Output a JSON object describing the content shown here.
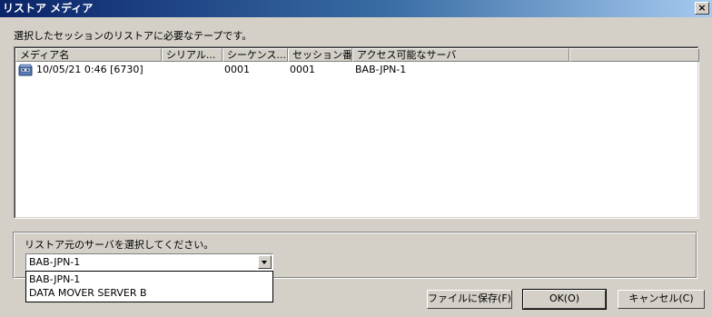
{
  "window": {
    "title": "リストア メディア",
    "close_label": "×"
  },
  "instruction": "選択したセッションのリストアに必要なテープです。",
  "table": {
    "columns": [
      "メディア名",
      "シリアル...",
      "シーケンス...",
      "セッション番...",
      "アクセス可能なサーバ"
    ],
    "rows": [
      {
        "icon": "tape-media-icon",
        "media_name": "10/05/21 0:46 [6730]",
        "serial": "",
        "sequence": "0001",
        "session": "0001",
        "server": "BAB-JPN-1"
      }
    ]
  },
  "server_select": {
    "label": "リストア元のサーバを選択してください。",
    "selected": "BAB-JPN-1",
    "options": [
      "BAB-JPN-1",
      "DATA MOVER SERVER B"
    ]
  },
  "buttons": {
    "save_to_file": "ファイルに保存(F)",
    "ok": "OK(O)",
    "cancel": "キャンセル(C)"
  }
}
